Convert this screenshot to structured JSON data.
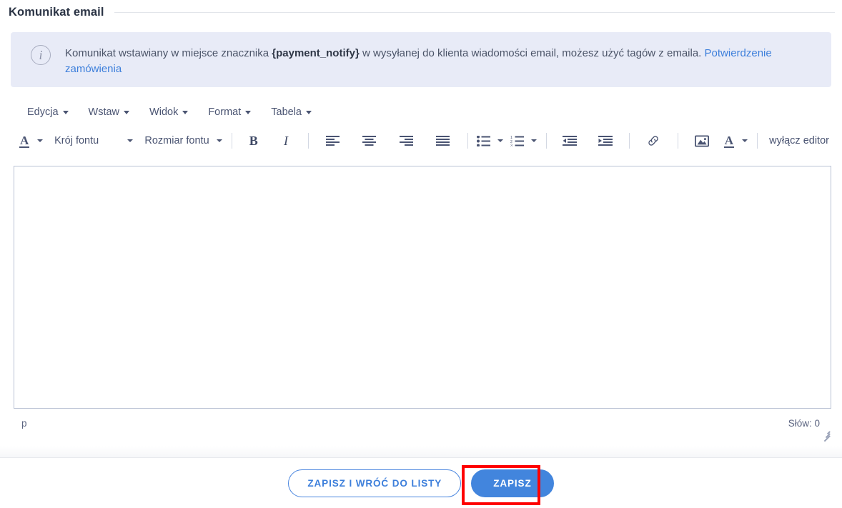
{
  "section": {
    "title": "Komunikat email"
  },
  "alert": {
    "icon": "info-circle-icon",
    "icon_glyph": "i",
    "text_part1": "Komunikat wstawiany w miejsce znacznika ",
    "placeholder_tag": "{payment_notify}",
    "text_part2": " w wysyłanej do klienta wiadomości email, możesz użyć tagów z emaila. ",
    "link_label": "Potwierdzenie zamówienia",
    "background": "#e8ebf7",
    "link_color": "#3d7fdb"
  },
  "editor": {
    "menubar": [
      {
        "label": "Edycja"
      },
      {
        "label": "Wstaw"
      },
      {
        "label": "Widok"
      },
      {
        "label": "Format"
      },
      {
        "label": "Tabela"
      }
    ],
    "toolbar": {
      "text_color_icon": "text-color-a-icon",
      "text_color_glyph": "A",
      "font_family_label": "Krój fontu",
      "font_size_label": "Rozmiar fontu",
      "bold_glyph": "B",
      "italic_glyph": "I",
      "align_left_icon": "align-left-icon",
      "align_center_icon": "align-center-icon",
      "align_right_icon": "align-right-icon",
      "align_justify_icon": "align-justify-icon",
      "bullet_list_icon": "bullet-list-icon",
      "numbered_list_icon": "numbered-list-icon",
      "outdent_icon": "outdent-icon",
      "indent_icon": "indent-icon",
      "link_icon": "link-icon",
      "image_icon": "image-icon",
      "forecolor_icon": "font-color-a-icon",
      "forecolor_glyph": "A",
      "disable_editor_label": "wyłącz editor"
    },
    "content": "",
    "statusbar": {
      "element_path": "p",
      "word_count_label": "Słów: 0",
      "resize_handle": "resize-grip-icon"
    }
  },
  "footer": {
    "save_and_back_label": "ZAPISZ I WRÓĆ DO LISTY",
    "save_label": "ZAPISZ",
    "primary_color": "#4285dd",
    "highlight_color": "#fe0000"
  }
}
